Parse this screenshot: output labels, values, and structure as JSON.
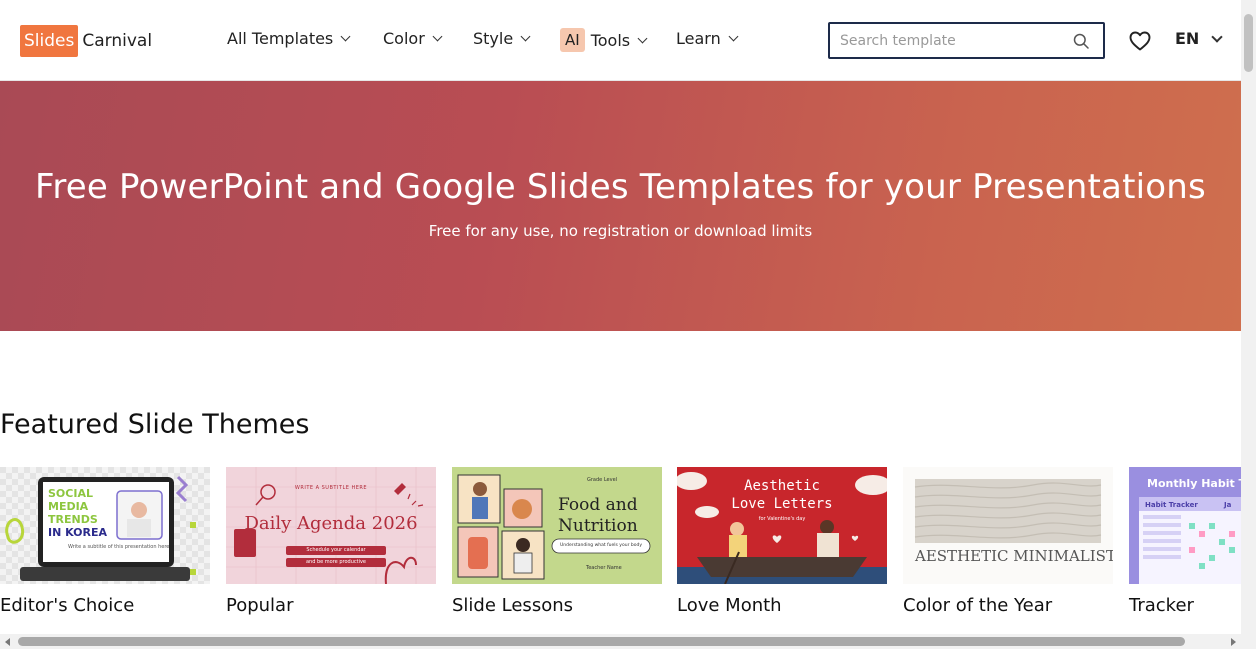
{
  "header": {
    "logo_box": "Slides",
    "logo_text": "Carnival",
    "nav": [
      {
        "label": "All Templates"
      },
      {
        "label": "Color"
      },
      {
        "label": "Style"
      },
      {
        "label": "Tools",
        "badge": "AI"
      },
      {
        "label": "Learn"
      }
    ],
    "search_placeholder": "Search template",
    "lang": "EN"
  },
  "hero": {
    "title": "Free PowerPoint and Google Slides Templates for your Presentations",
    "subtitle": "Free for any use, no registration or download limits"
  },
  "featured": {
    "title": "Featured Slide Themes",
    "cards": [
      {
        "label": "Editor's Choice",
        "thumb_lines": [
          "SOCIAL",
          "MEDIA",
          "TRENDS",
          "IN KOREA"
        ],
        "thumb_caption": "Write a subtitle of this presentation here"
      },
      {
        "label": "Popular",
        "thumb_top": "WRITE A SUBTITLE HERE",
        "thumb_title": "Daily Agenda 2026",
        "thumb_lines": [
          "Schedule your calendar",
          "and be more productive"
        ]
      },
      {
        "label": "Slide Lessons",
        "thumb_top": "Grade Level",
        "thumb_title_1": "Food and",
        "thumb_title_2": "Nutrition",
        "thumb_pill": "Understanding what fuels your body",
        "thumb_footer": "Teacher Name"
      },
      {
        "label": "Love Month",
        "thumb_title_1": "Aesthetic",
        "thumb_title_2": "Love Letters",
        "thumb_sub": "for Valentine's day"
      },
      {
        "label": "Color of the Year",
        "thumb_title": "AESTHETIC MINIMALIST"
      },
      {
        "label": "Tracker",
        "thumb_title": "Monthly Habit T",
        "thumb_sub": "Habit Tracker",
        "thumb_sub2": "Ja"
      }
    ]
  },
  "colors": {
    "brand_orange": "#f0763f",
    "hero_start": "#a94a55",
    "hero_end": "#cf6f4e",
    "search_border": "#1d2b4a"
  }
}
